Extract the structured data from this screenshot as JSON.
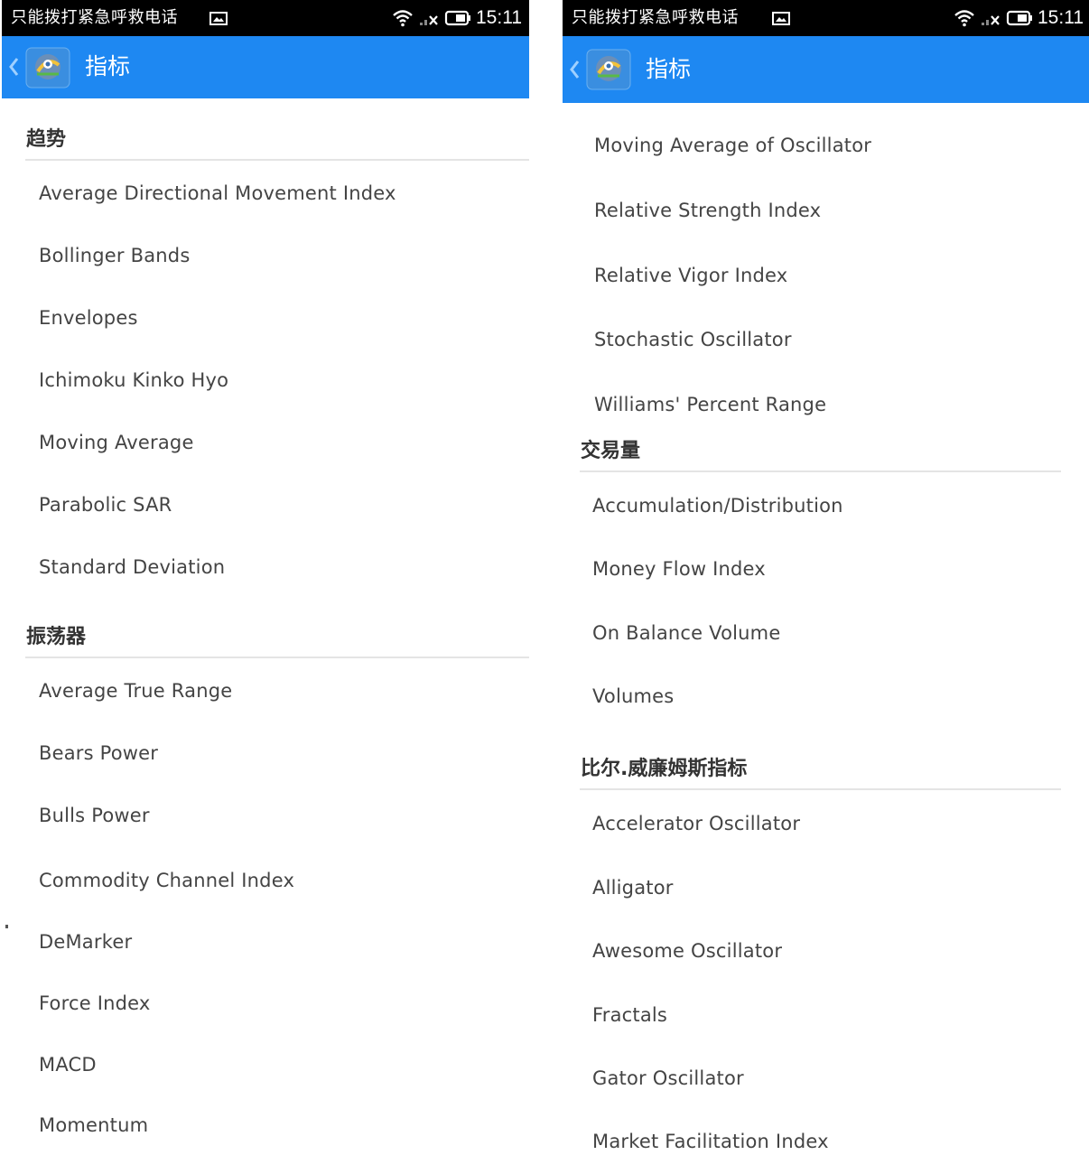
{
  "panels": [
    {
      "id": "left",
      "status_bar": {
        "carrier_text": "只能拨打紧急呼救电话",
        "time": "15:11",
        "icons": [
          "image-icon",
          "wifi-icon",
          "signal-icon",
          "battery-icon"
        ]
      },
      "app_bar": {
        "title": "指标",
        "icons": [
          "back-chevron-icon",
          "metatrader-app-icon"
        ]
      },
      "sections": [
        {
          "title": "趋势",
          "items": [
            "Average Directional Movement Index",
            "Bollinger Bands",
            "Envelopes",
            "Ichimoku Kinko Hyo",
            "Moving Average",
            "Parabolic SAR",
            "Standard Deviation"
          ]
        },
        {
          "title": "振荡器",
          "items": [
            "Average True Range",
            "Bears Power",
            "Bulls Power",
            "Commodity Channel Index",
            "DeMarker",
            "Force Index",
            "MACD",
            "Momentum"
          ]
        }
      ]
    },
    {
      "id": "right",
      "status_bar": {
        "carrier_text": "只能拨打紧急呼救电话",
        "time": "15:11",
        "icons": [
          "image-icon",
          "wifi-icon",
          "signal-icon",
          "battery-icon"
        ]
      },
      "app_bar": {
        "title": "指标",
        "icons": [
          "back-chevron-icon",
          "metatrader-app-icon"
        ]
      },
      "continued_items": [
        "Moving Average of Oscillator",
        "Relative Strength Index",
        "Relative Vigor Index",
        "Stochastic Oscillator",
        "Williams' Percent Range"
      ],
      "sections": [
        {
          "title": "交易量",
          "items": [
            "Accumulation/Distribution",
            "Money Flow Index",
            "On Balance Volume",
            "Volumes"
          ]
        },
        {
          "title": "比尔.威廉姆斯指标",
          "items": [
            "Accelerator Oscillator",
            "Alligator",
            "Awesome Oscillator",
            "Fractals",
            "Gator Oscillator",
            "Market Facilitation Index"
          ]
        }
      ]
    }
  ],
  "colors": {
    "status_bar": "#000000",
    "app_bar": "#1e88f2",
    "back_chevron": "#9fd0ff",
    "divider": "#e4e4e4",
    "section_title": "#333333",
    "item_text": "#444444"
  }
}
